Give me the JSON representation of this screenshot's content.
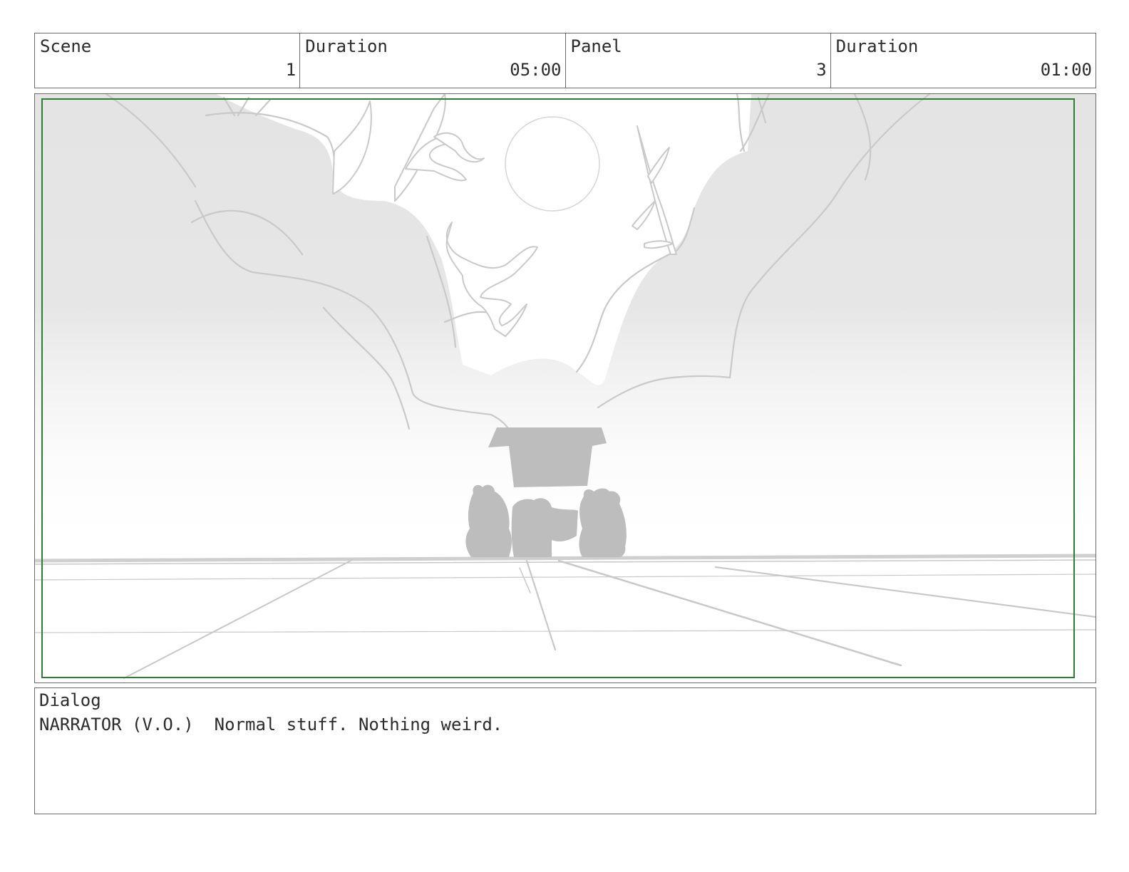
{
  "header": {
    "scene": {
      "label": "Scene",
      "value": "1"
    },
    "scene_duration": {
      "label": "Duration",
      "value": "05:00"
    },
    "panel": {
      "label": "Panel",
      "value": "3"
    },
    "panel_duration": {
      "label": "Duration",
      "value": "01:00"
    }
  },
  "dialog": {
    "label": "Dialog",
    "speaker": "NARRATOR (V.O.)",
    "line": "Normal stuff. Nothing weird."
  },
  "colors": {
    "safe_frame": "#2e7d32",
    "border": "#6a6a6a",
    "sketch_fill": "#e4e4e4",
    "silhouette": "#bdbdbd"
  }
}
